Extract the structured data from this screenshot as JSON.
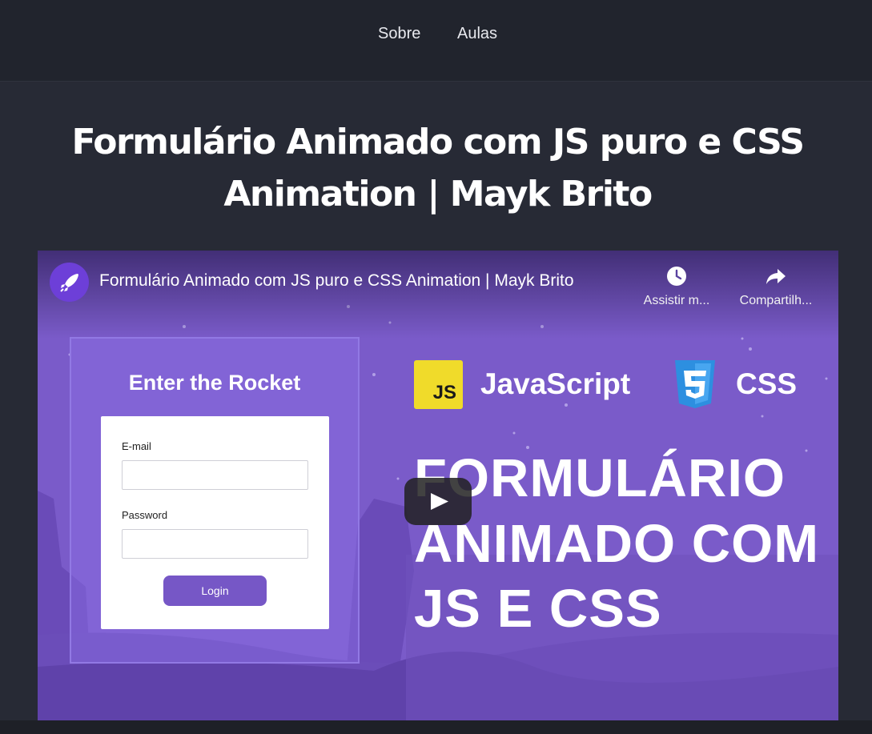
{
  "nav": {
    "items": [
      {
        "label": "Sobre"
      },
      {
        "label": "Aulas"
      }
    ]
  },
  "page": {
    "title_line1": "Formulário Animado com JS puro e CSS",
    "title_line2": "Animation | Mayk Brito"
  },
  "video": {
    "title": "Formulário Animado com JS puro e CSS Animation | Mayk Brito",
    "actions": {
      "watch_later": {
        "label": "Assistir m...",
        "icon": "clock-icon"
      },
      "share": {
        "label": "Compartilh...",
        "icon": "share-icon"
      }
    },
    "thumbnail": {
      "form_heading": "Enter the Rocket",
      "email_label": "E-mail",
      "password_label": "Password",
      "login_button": "Login",
      "js_badge": "JS",
      "js_label": "JavaScript",
      "css_label": "CSS",
      "headline": [
        "FORMULÁRIO",
        "ANIMADO COM",
        "JS E CSS"
      ]
    }
  },
  "colors": {
    "header_bg": "#21242d",
    "page_bg": "#272a35",
    "thumbnail_purple": "#7a5bc9",
    "js_yellow": "#f0db2a",
    "css_blue": "#2d8fe0"
  }
}
